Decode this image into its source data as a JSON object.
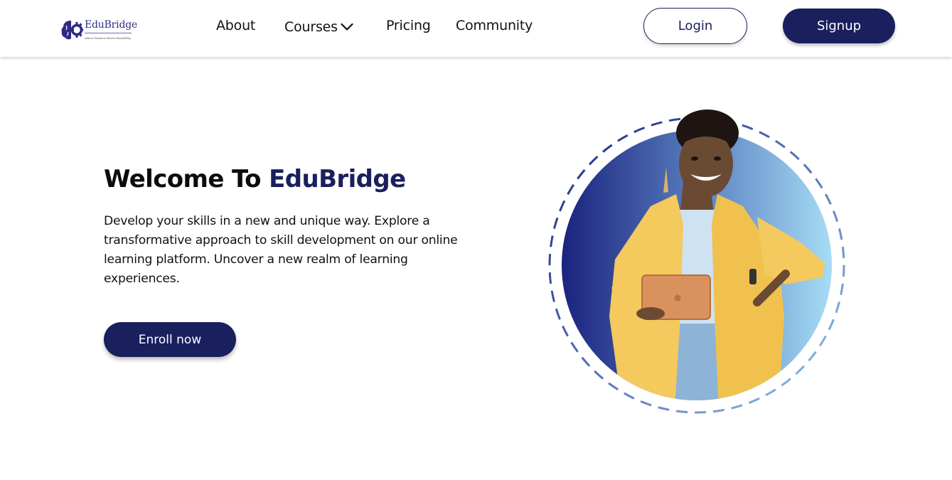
{
  "header": {
    "logo": {
      "name": "EduBridge",
      "tagline": "where Passion Meets Possibility",
      "icon": "brain-gear-icon"
    },
    "nav": {
      "about": "About",
      "courses": "Courses",
      "pricing": "Pricing",
      "community": "Community"
    },
    "login_label": "Login",
    "signup_label": "Signup"
  },
  "hero": {
    "title_prefix": "Welcome To ",
    "title_brand": "EduBridge",
    "description": "Develop your skills in a new and unique way. Explore a transformative approach to skill development on our online learning platform. Uncover a new realm of learning experiences.",
    "cta_label": "Enroll now"
  },
  "colors": {
    "brand_navy": "#1a1f5e",
    "gradient_start": "#1a237e",
    "gradient_end": "#a6dcf5",
    "jacket_yellow": "#f4c95d"
  }
}
